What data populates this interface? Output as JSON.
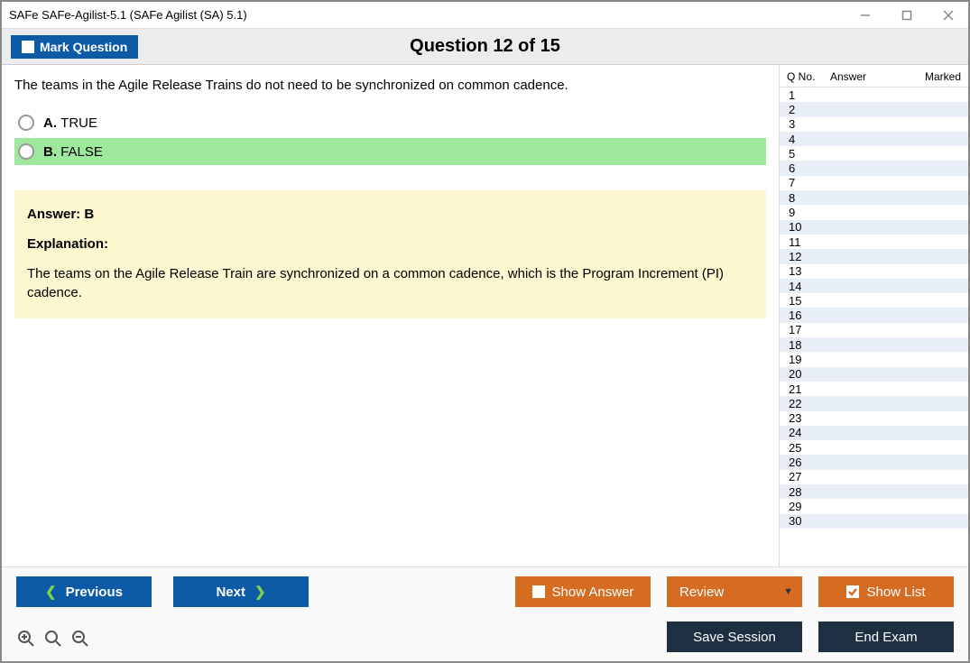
{
  "window_title": "SAFe SAFe-Agilist-5.1 (SAFe Agilist (SA) 5.1)",
  "topbar": {
    "mark_label": "Mark Question",
    "question_label": "Question 12 of 15"
  },
  "question": {
    "text": "The teams in the Agile Release Trains do not need to be synchronized on common cadence.",
    "options": [
      {
        "letter": "A.",
        "text": "TRUE",
        "correct": false
      },
      {
        "letter": "B.",
        "text": "FALSE",
        "correct": true
      }
    ],
    "answer_line": "Answer: B",
    "explanation_label": "Explanation:",
    "explanation_text": "The teams on the Agile Release Train are synchronized on a common cadence, which is the Program Increment (PI) cadence."
  },
  "list": {
    "headers": {
      "qno": "Q No.",
      "answer": "Answer",
      "marked": "Marked"
    },
    "count": 30
  },
  "buttons": {
    "previous": "Previous",
    "next": "Next",
    "show_answer": "Show Answer",
    "review": "Review",
    "show_list": "Show List",
    "save_session": "Save Session",
    "end_exam": "End Exam"
  }
}
